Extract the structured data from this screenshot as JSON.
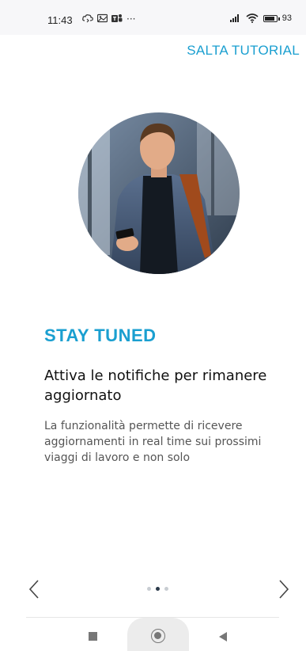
{
  "status_bar": {
    "time": "11:43",
    "extra_icons": [
      "cloud-sync-icon",
      "photo-icon",
      "teams-icon",
      "more-icon"
    ],
    "overflow": "···",
    "battery_percent": 93,
    "battery_text": "93"
  },
  "header": {
    "skip_label": "SALTA TUTORIAL"
  },
  "slide": {
    "headline": "STAY TUNED",
    "subtitle": "Attiva le notifiche per rimanere aggiornato",
    "description": "La funzionalità permette di ricevere aggiornamenti in real time sui prossimi viaggi di lavoro e non solo"
  },
  "pager": {
    "total": 3,
    "active_index": 1
  },
  "colors": {
    "accent": "#1a9fd0",
    "text_dark": "#111111",
    "text_muted": "#555555",
    "dot_active": "#2b3a4a",
    "dot_inactive": "#c8cdd2"
  }
}
